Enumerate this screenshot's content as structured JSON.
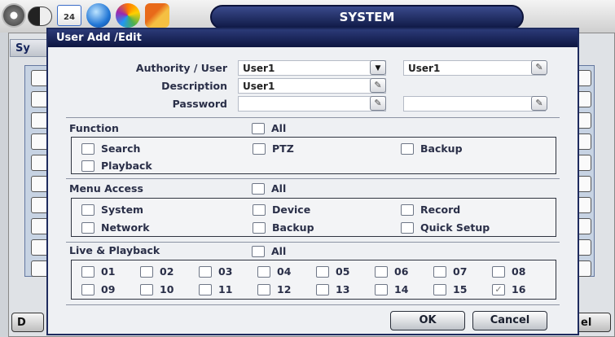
{
  "topbar": {
    "calendar_icon_text": "24",
    "system_title": "SYSTEM"
  },
  "background": {
    "tab_label": "Sy",
    "left_button": "D",
    "right_button": "el"
  },
  "dialog": {
    "title": "User Add /Edit",
    "authority_label": "Authority / User",
    "authority_value": "User1",
    "user_value": "User1",
    "description_label": "Description",
    "description_value": "User1",
    "password_label": "Password",
    "password_value": "",
    "password_confirm_value": ""
  },
  "function": {
    "label": "Function",
    "all_label": "All",
    "items": [
      "Search",
      "PTZ",
      "Backup",
      "Playback"
    ]
  },
  "menu_access": {
    "label": "Menu Access",
    "all_label": "All",
    "items": [
      "System",
      "Device",
      "Record",
      "Network",
      "Backup",
      "Quick Setup"
    ]
  },
  "live_playback": {
    "label": "Live & Playback",
    "all_label": "All",
    "channels": [
      "01",
      "02",
      "03",
      "04",
      "05",
      "06",
      "07",
      "08",
      "09",
      "10",
      "11",
      "12",
      "13",
      "14",
      "15",
      "16"
    ]
  },
  "buttons": {
    "ok": "OK",
    "cancel": "Cancel"
  }
}
